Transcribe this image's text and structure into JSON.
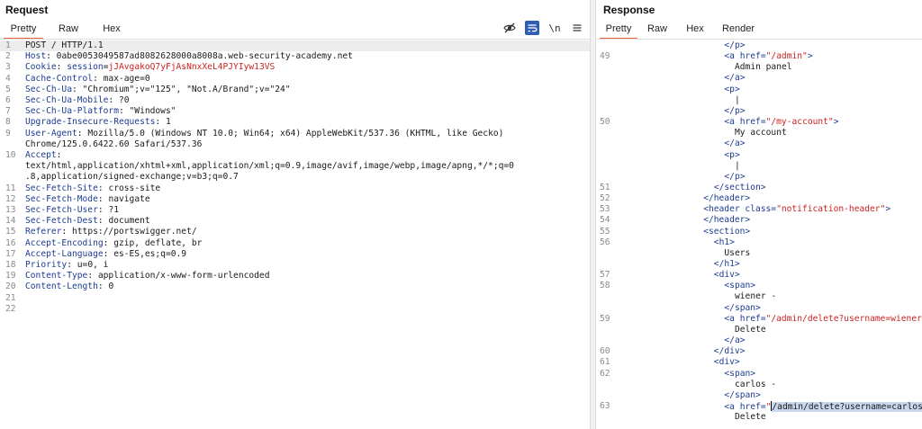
{
  "request": {
    "title": "Request",
    "tabs": [
      "Pretty",
      "Raw",
      "Hex"
    ],
    "active_tab": "Pretty",
    "toolbar": {
      "newline_label": "\\n",
      "icons": [
        "eye-off-icon",
        "wrap-icon",
        "newline-icon",
        "menu-icon"
      ]
    },
    "lines": [
      {
        "n": "1",
        "text": "POST / HTTP/1.1"
      },
      {
        "n": "2",
        "key": "Host",
        "value": "0abe0053049587ad8082628000a8008a.web-security-academy.net"
      },
      {
        "n": "3",
        "key": "Cookie",
        "cookie_name": "session",
        "cookie_value": "jJAvgakoQ7yFjAsNnxXeL4PJYIyw13VS"
      },
      {
        "n": "4",
        "key": "Cache-Control",
        "value": "max-age=0"
      },
      {
        "n": "5",
        "key": "Sec-Ch-Ua",
        "value": "\"Chromium\";v=\"125\", \"Not.A/Brand\";v=\"24\""
      },
      {
        "n": "6",
        "key": "Sec-Ch-Ua-Mobile",
        "value": "?0"
      },
      {
        "n": "7",
        "key": "Sec-Ch-Ua-Platform",
        "value": "\"Windows\""
      },
      {
        "n": "8",
        "key": "Upgrade-Insecure-Requests",
        "value": "1"
      },
      {
        "n": "9",
        "key": "User-Agent",
        "value": "Mozilla/5.0 (Windows NT 10.0; Win64; x64) AppleWebKit/537.36 (KHTML, like Gecko)"
      },
      {
        "n": "",
        "text": "Chrome/125.0.6422.60 Safari/537.36"
      },
      {
        "n": "10",
        "key": "Accept",
        "value": ""
      },
      {
        "n": "",
        "text": "text/html,application/xhtml+xml,application/xml;q=0.9,image/avif,image/webp,image/apng,*/*;q=0"
      },
      {
        "n": "",
        "text": ".8,application/signed-exchange;v=b3;q=0.7"
      },
      {
        "n": "11",
        "key": "Sec-Fetch-Site",
        "value": "cross-site"
      },
      {
        "n": "12",
        "key": "Sec-Fetch-Mode",
        "value": "navigate"
      },
      {
        "n": "13",
        "key": "Sec-Fetch-User",
        "value": "?1"
      },
      {
        "n": "14",
        "key": "Sec-Fetch-Dest",
        "value": "document"
      },
      {
        "n": "15",
        "key": "Referer",
        "value": "https://portswigger.net/"
      },
      {
        "n": "16",
        "key": "Accept-Encoding",
        "value": "gzip, deflate, br"
      },
      {
        "n": "17",
        "key": "Accept-Language",
        "value": "es-ES,es;q=0.9"
      },
      {
        "n": "18",
        "key": "Priority",
        "value": "u=0, i"
      },
      {
        "n": "19",
        "key": "Content-Type",
        "value": "application/x-www-form-urlencoded"
      },
      {
        "n": "20",
        "key": "Content-Length",
        "value": "0"
      },
      {
        "n": "21",
        "text": ""
      },
      {
        "n": "22",
        "text": ""
      }
    ]
  },
  "response": {
    "title": "Response",
    "tabs": [
      "Pretty",
      "Raw",
      "Hex",
      "Render"
    ],
    "active_tab": "Pretty",
    "lines": [
      {
        "n": "",
        "indent": 9,
        "parts": [
          [
            "t",
            "</p>"
          ]
        ]
      },
      {
        "n": "49",
        "indent": 9,
        "parts": [
          [
            "t",
            "<a "
          ],
          [
            "a",
            "href="
          ],
          [
            "s",
            "\"/admin\""
          ],
          [
            "t",
            ">"
          ]
        ]
      },
      {
        "n": "",
        "indent": 10,
        "parts": [
          [
            "p",
            "Admin panel"
          ]
        ]
      },
      {
        "n": "",
        "indent": 9,
        "parts": [
          [
            "t",
            "</a>"
          ]
        ]
      },
      {
        "n": "",
        "indent": 9,
        "parts": [
          [
            "t",
            "<p>"
          ]
        ]
      },
      {
        "n": "",
        "indent": 10,
        "parts": [
          [
            "p",
            "|"
          ]
        ]
      },
      {
        "n": "",
        "indent": 9,
        "parts": [
          [
            "t",
            "</p>"
          ]
        ]
      },
      {
        "n": "50",
        "indent": 9,
        "parts": [
          [
            "t",
            "<a "
          ],
          [
            "a",
            "href="
          ],
          [
            "s",
            "\"/my-account\""
          ],
          [
            "t",
            ">"
          ]
        ]
      },
      {
        "n": "",
        "indent": 10,
        "parts": [
          [
            "p",
            "My account"
          ]
        ]
      },
      {
        "n": "",
        "indent": 9,
        "parts": [
          [
            "t",
            "</a>"
          ]
        ]
      },
      {
        "n": "",
        "indent": 9,
        "parts": [
          [
            "t",
            "<p>"
          ]
        ]
      },
      {
        "n": "",
        "indent": 10,
        "parts": [
          [
            "p",
            "|"
          ]
        ]
      },
      {
        "n": "",
        "indent": 9,
        "parts": [
          [
            "t",
            "</p>"
          ]
        ]
      },
      {
        "n": "51",
        "indent": 8,
        "parts": [
          [
            "t",
            "</section>"
          ]
        ]
      },
      {
        "n": "52",
        "indent": 7,
        "parts": [
          [
            "t",
            "</header>"
          ]
        ]
      },
      {
        "n": "53",
        "indent": 7,
        "parts": [
          [
            "t",
            "<header "
          ],
          [
            "a",
            "class="
          ],
          [
            "s",
            "\"notification-header\""
          ],
          [
            "t",
            ">"
          ]
        ]
      },
      {
        "n": "54",
        "indent": 7,
        "parts": [
          [
            "t",
            "</header>"
          ]
        ]
      },
      {
        "n": "55",
        "indent": 7,
        "parts": [
          [
            "t",
            "<section>"
          ]
        ]
      },
      {
        "n": "56",
        "indent": 8,
        "parts": [
          [
            "t",
            "<h1>"
          ]
        ]
      },
      {
        "n": "",
        "indent": 9,
        "parts": [
          [
            "p",
            "Users"
          ]
        ]
      },
      {
        "n": "",
        "indent": 8,
        "parts": [
          [
            "t",
            "</h1>"
          ]
        ]
      },
      {
        "n": "57",
        "indent": 8,
        "parts": [
          [
            "t",
            "<div>"
          ]
        ]
      },
      {
        "n": "58",
        "indent": 9,
        "parts": [
          [
            "t",
            "<span>"
          ]
        ]
      },
      {
        "n": "",
        "indent": 10,
        "parts": [
          [
            "p",
            "wiener -"
          ]
        ]
      },
      {
        "n": "",
        "indent": 9,
        "parts": [
          [
            "t",
            "</span>"
          ]
        ]
      },
      {
        "n": "59",
        "indent": 9,
        "parts": [
          [
            "t",
            "<a "
          ],
          [
            "a",
            "href="
          ],
          [
            "s",
            "\"/admin/delete?username=wiener\""
          ],
          [
            "t",
            ">"
          ]
        ]
      },
      {
        "n": "",
        "indent": 10,
        "parts": [
          [
            "p",
            "Delete"
          ]
        ]
      },
      {
        "n": "",
        "indent": 9,
        "parts": [
          [
            "t",
            "</a>"
          ]
        ]
      },
      {
        "n": "60",
        "indent": 8,
        "parts": [
          [
            "t",
            "</div>"
          ]
        ]
      },
      {
        "n": "61",
        "indent": 8,
        "parts": [
          [
            "t",
            "<div>"
          ]
        ]
      },
      {
        "n": "62",
        "indent": 9,
        "parts": [
          [
            "t",
            "<span>"
          ]
        ]
      },
      {
        "n": "",
        "indent": 10,
        "parts": [
          [
            "p",
            "carlos -"
          ]
        ]
      },
      {
        "n": "",
        "indent": 9,
        "parts": [
          [
            "t",
            "</span>"
          ]
        ]
      },
      {
        "n": "63",
        "indent": 9,
        "parts": [
          [
            "t",
            "<a "
          ],
          [
            "a",
            "href="
          ],
          [
            "s",
            "\""
          ],
          [
            "caret",
            ""
          ],
          [
            "sel",
            "/admin/delete?username=carlos"
          ],
          [
            "s",
            "\""
          ],
          [
            "t",
            ">"
          ]
        ]
      },
      {
        "n": "",
        "indent": 10,
        "parts": [
          [
            "p",
            "Delete"
          ]
        ]
      }
    ]
  }
}
